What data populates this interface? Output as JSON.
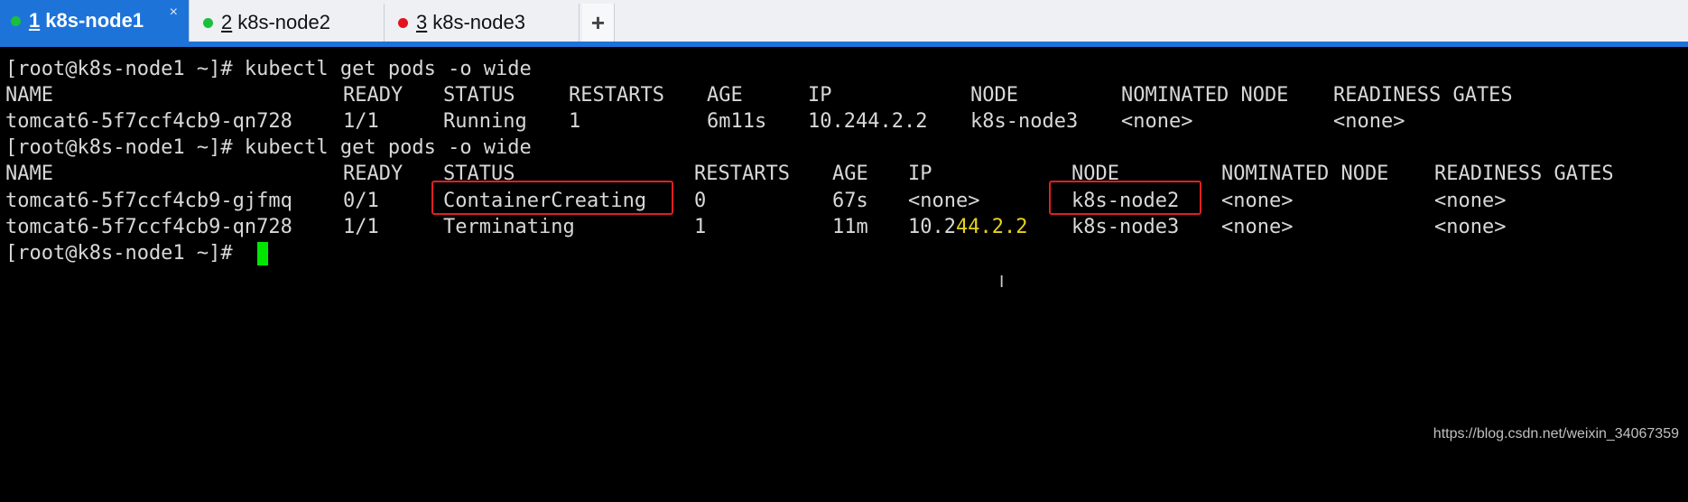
{
  "tabs": [
    {
      "num": "1",
      "label": "k8s-node1",
      "dot": "#19c03b",
      "close": "×"
    },
    {
      "num": "2",
      "label": "k8s-node2",
      "dot": "#19c03b"
    },
    {
      "num": "3",
      "label": "k8s-node3",
      "dot": "#e3141c"
    }
  ],
  "add_tab": "+",
  "terminal": {
    "cmd1": "[root@k8s-node1 ~]# kubectl get pods -o wide",
    "h1": [
      "NAME",
      "READY",
      "STATUS",
      "RESTARTS",
      "AGE",
      "IP",
      "NODE",
      "NOMINATED NODE",
      "READINESS GATES"
    ],
    "r1": [
      "tomcat6-5f7ccf4cb9-qn728",
      "1/1",
      "Running",
      "1",
      "6m11s",
      "10.244.2.2",
      "k8s-node3",
      "<none>",
      "<none>"
    ],
    "cmd2": "[root@k8s-node1 ~]# kubectl get pods -o wide",
    "h2": [
      "NAME",
      "READY",
      "STATUS",
      "RESTARTS",
      "AGE",
      "IP",
      "NODE",
      "NOMINATED NODE",
      "READINESS GATES"
    ],
    "r2": [
      "tomcat6-5f7ccf4cb9-gjfmq",
      "0/1",
      "ContainerCreating",
      "0",
      "67s",
      "<none>",
      "k8s-node2",
      "<none>",
      "<none>"
    ],
    "r3": [
      "tomcat6-5f7ccf4cb9-qn728",
      "1/1",
      "Terminating",
      "1",
      "11m",
      "10.2",
      "44.2.2",
      "k8s-node3",
      "<none>",
      "<none>"
    ],
    "prompt": "[root@k8s-node1 ~]# "
  },
  "ibeam": "I",
  "watermark": "https://blog.csdn.net/weixin_34067359"
}
